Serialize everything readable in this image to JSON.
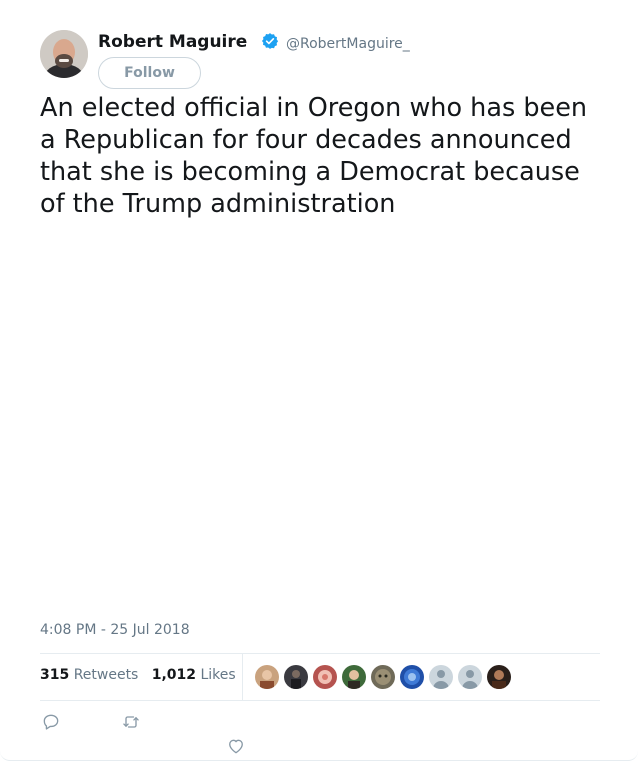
{
  "author": {
    "name": "Robert Maguire",
    "handle": "@RobertMaguire_",
    "verified": true
  },
  "follow_label": "Follow",
  "tweet_text": "An elected official in Oregon who has been a Republican for four decades announced that she is becoming a Democrat because of the Trump administration",
  "timestamp": "4:08 PM - 25 Jul 2018",
  "stats": {
    "retweets_count": "315",
    "retweets_label": "Retweets",
    "likes_count": "1,012",
    "likes_label": "Likes"
  },
  "colors": {
    "accent": "#1da1f2",
    "text": "#14171a",
    "muted": "#657786",
    "border": "#e6ecf0"
  },
  "icons": [
    "verified-badge-icon",
    "reply-icon",
    "retweet-icon",
    "like-icon"
  ]
}
